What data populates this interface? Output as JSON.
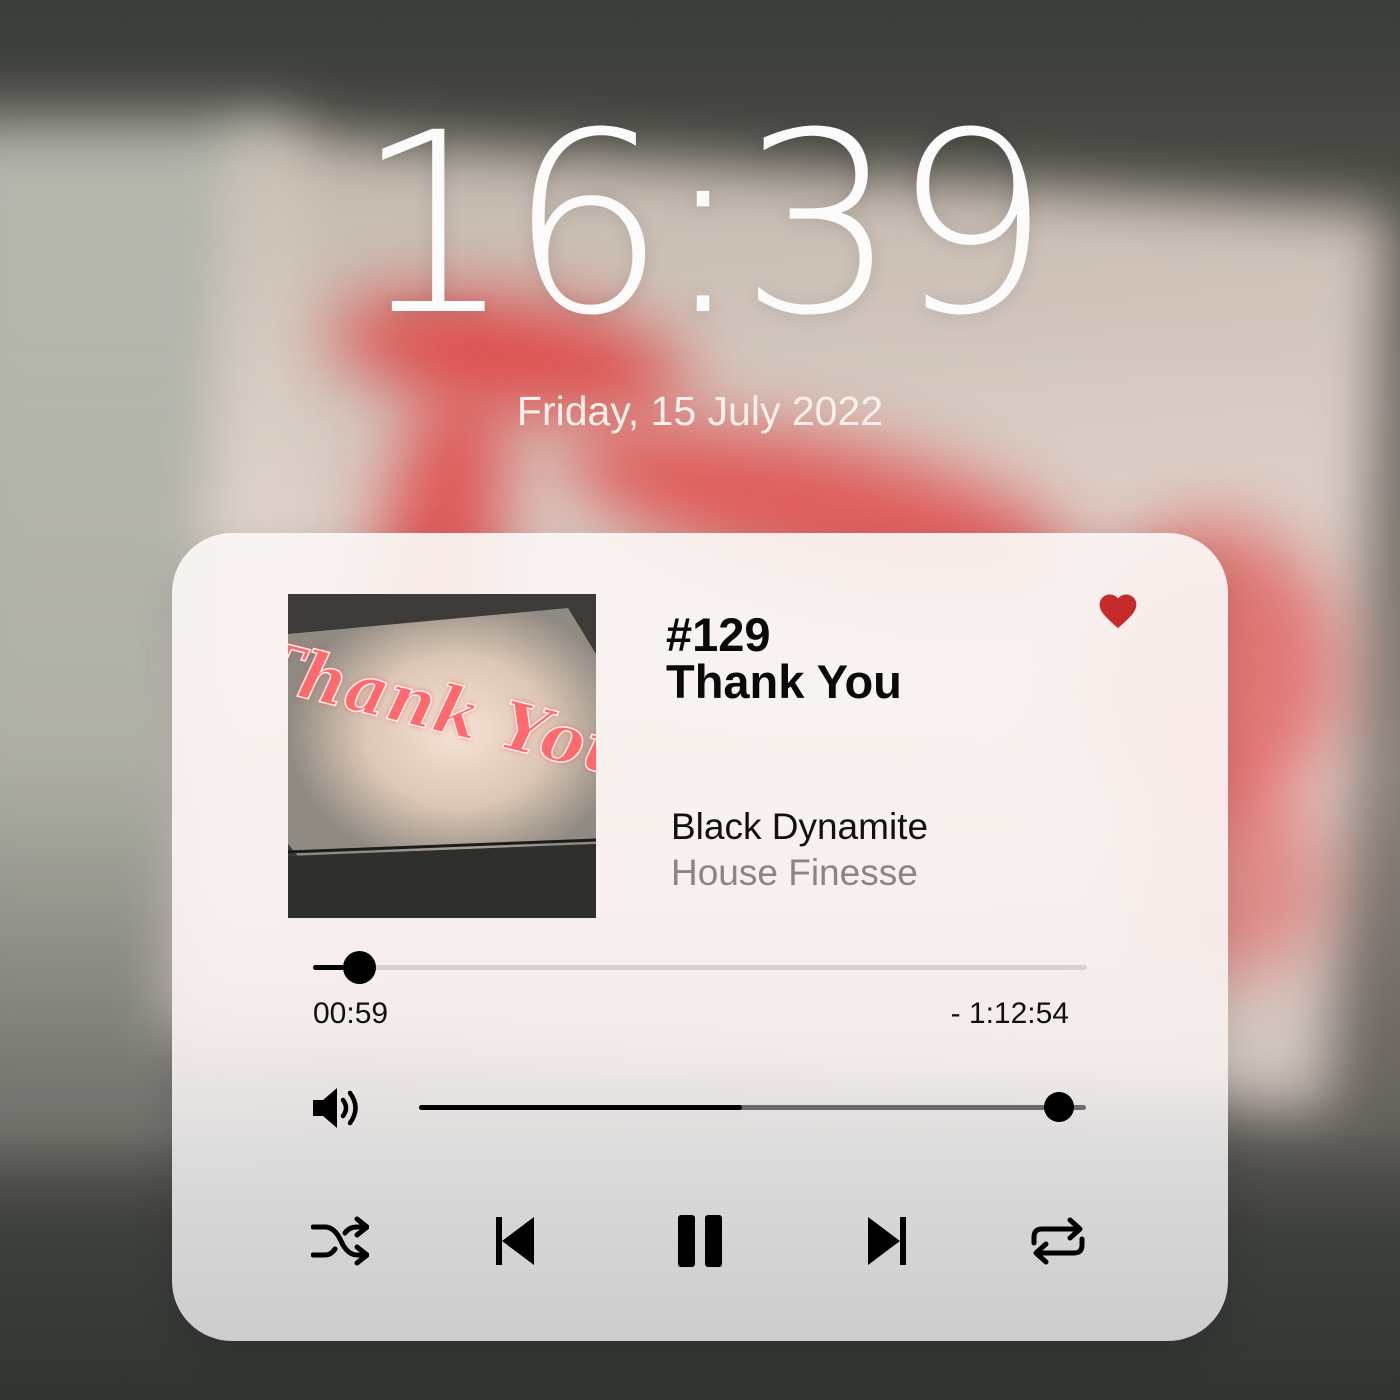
{
  "lock_screen": {
    "time": "16:39",
    "date": "Friday, 15 July 2022"
  },
  "player": {
    "artwork_text": "Thank You!",
    "episode_number": "#129",
    "title": "Thank You",
    "artist": "Black Dynamite",
    "album": "House Finesse",
    "favorite_icon": "heart-icon",
    "favorited": true,
    "progress": {
      "elapsed": "00:59",
      "remaining": "- 1:12:54",
      "fraction": 0.059
    },
    "volume": {
      "icon": "speaker-icon",
      "fraction": 0.96,
      "buffered_fraction": 0.485
    },
    "controls": [
      {
        "name": "shuffle",
        "icon": "shuffle-icon"
      },
      {
        "name": "previous",
        "icon": "skip-back-icon"
      },
      {
        "name": "pause",
        "icon": "pause-icon"
      },
      {
        "name": "next",
        "icon": "skip-forward-icon"
      },
      {
        "name": "repeat",
        "icon": "repeat-icon"
      }
    ]
  },
  "colors": {
    "accent": "#000000",
    "favorite": "#c62b2b",
    "muted_text": "#8a8685",
    "clock_text": "#fbfbfb"
  }
}
